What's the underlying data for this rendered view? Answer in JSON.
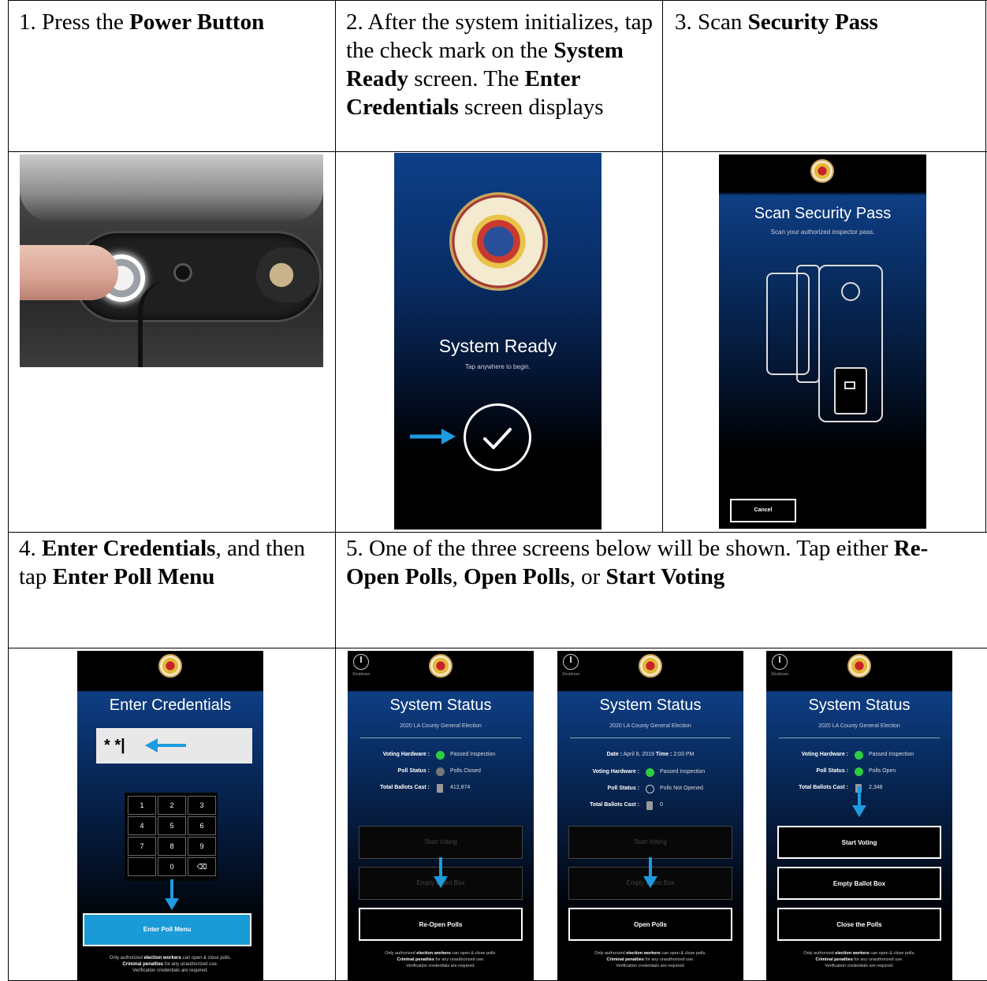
{
  "steps": {
    "s1": {
      "num": "1. Press the ",
      "bold": "Power Button"
    },
    "s2": {
      "num": "2. After the system initializes, tap the check mark on the ",
      "bold1": "System Ready",
      "mid": " screen. The ",
      "bold2": "Enter Credentials",
      "end": " screen displays"
    },
    "s3": {
      "num": "3. Scan ",
      "bold": "Security Pass"
    },
    "s4": {
      "num": "4. ",
      "bold1": "Enter Credentials",
      "mid": ", and then tap ",
      "bold2": "Enter Poll Menu"
    },
    "s5": {
      "num": "5. One of the three screens below will be shown. Tap either ",
      "bold1": "Re-Open Polls",
      "sep1": ", ",
      "bold2": "Open Polls",
      "sep2": ", or ",
      "bold3": "Start Voting"
    }
  },
  "system_ready": {
    "title": "System Ready",
    "subtitle": "Tap anywhere to begin."
  },
  "scan_pass": {
    "title": "Scan Security Pass",
    "subtitle": "Scan your authorized inspector pass.",
    "cancel": "Cancel"
  },
  "credentials": {
    "title": "Enter Credentials",
    "input_value": "* *|",
    "keys": [
      "1",
      "2",
      "3",
      "4",
      "5",
      "6",
      "7",
      "8",
      "9",
      "",
      "0",
      "⌫"
    ],
    "button": "Enter Poll Menu",
    "footer1": "Only authorized ",
    "footer1b": "election workers",
    "footer1c": " can open & close polls.",
    "footer2b": "Criminal penalties",
    "footer2c": " for any unauthorized use.",
    "footer3": "Verification credentials are required."
  },
  "status_common": {
    "title": "System Status",
    "subtitle": "2020 LA County General Election",
    "power_label": "Shutdown",
    "footer1": "Only authorized ",
    "footer1b": "election workers",
    "footer1c": " can open & close polls.",
    "footer2b": "Criminal penalties",
    "footer2c": " for any unauthorized use.",
    "footer3": "Verification credentials are required."
  },
  "status_a": {
    "rows": [
      {
        "label": "Voting Hardware :",
        "value": "Passed Inspection",
        "dot": "#2ecc40"
      },
      {
        "label": "Poll Status :",
        "value": "Polls Closed",
        "dot": "#777777"
      },
      {
        "label": "Total Ballots Cast :",
        "value": "412,874",
        "dot": "ballot"
      }
    ],
    "btn1": "Start Voting",
    "btn2": "Empty Ballot Box",
    "btn3": "Re-Open Polls"
  },
  "status_b": {
    "date_label": "Date :",
    "date_value": "April 8, 2019",
    "time_label": "Time :",
    "time_value": "2:03 PM",
    "rows": [
      {
        "label": "Voting Hardware :",
        "value": "Passed Inspection",
        "dot": "#2ecc40"
      },
      {
        "label": "Poll Status :",
        "value": "Polls Not Opened",
        "dot": "none"
      },
      {
        "label": "Total Ballots Cast :",
        "value": "0",
        "dot": "ballot"
      }
    ],
    "btn1": "Start Voting",
    "btn2": "Empty Ballot Box",
    "btn3": "Open Polls"
  },
  "status_c": {
    "rows": [
      {
        "label": "Voting Hardware :",
        "value": "Passed Inspection",
        "dot": "#2ecc40"
      },
      {
        "label": "Poll Status :",
        "value": "Polls Open",
        "dot": "#2ecc40"
      },
      {
        "label": "Total Ballots Cast :",
        "value": "2,348",
        "dot": "ballot"
      }
    ],
    "btn1": "Start Voting",
    "btn2": "Empty Ballot Box",
    "btn3": "Close the Polls"
  },
  "colors": {
    "accent_blue": "#1a9ad6",
    "arrow_blue": "#1e9be0"
  }
}
